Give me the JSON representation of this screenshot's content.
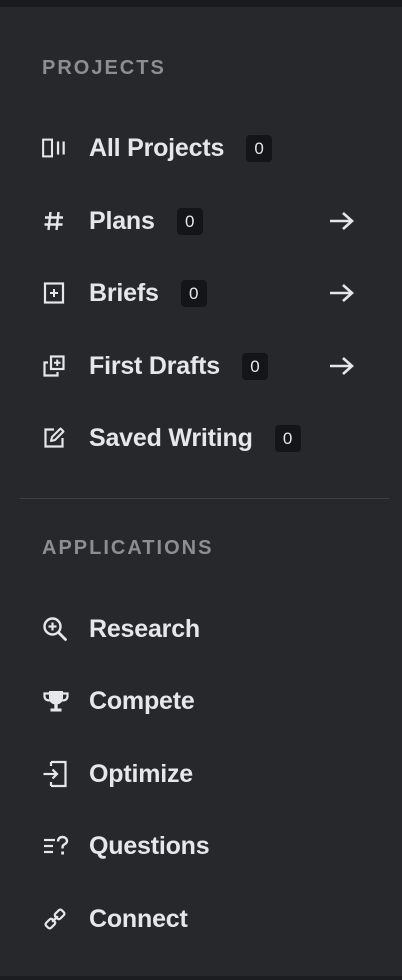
{
  "projects": {
    "heading": "PROJECTS",
    "items": [
      {
        "label": "All Projects",
        "count": "0",
        "icon": "columns-icon",
        "arrow": false
      },
      {
        "label": "Plans",
        "count": "0",
        "icon": "hash-icon",
        "arrow": true
      },
      {
        "label": "Briefs",
        "count": "0",
        "icon": "brief-icon",
        "arrow": true
      },
      {
        "label": "First Drafts",
        "count": "0",
        "icon": "drafts-icon",
        "arrow": true
      },
      {
        "label": "Saved Writing",
        "count": "0",
        "icon": "edit-icon",
        "arrow": false
      }
    ]
  },
  "applications": {
    "heading": "APPLICATIONS",
    "items": [
      {
        "label": "Research",
        "icon": "zoom-in-icon"
      },
      {
        "label": "Compete",
        "icon": "trophy-icon"
      },
      {
        "label": "Optimize",
        "icon": "login-icon"
      },
      {
        "label": "Questions",
        "icon": "questions-icon"
      },
      {
        "label": "Connect",
        "icon": "link-icon"
      }
    ]
  },
  "colors": {
    "background": "#26282c",
    "text": "#e6e7e9",
    "heading": "#8c8e93",
    "badge": "#141518"
  }
}
